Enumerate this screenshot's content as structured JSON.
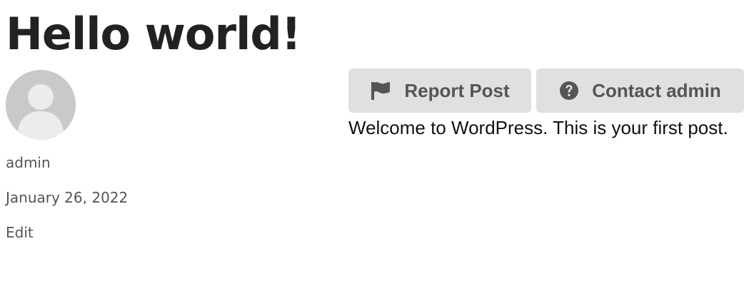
{
  "post": {
    "title": "Hello world!",
    "author": "admin",
    "date": "January 26, 2022",
    "edit_label": "Edit",
    "content": "Welcome to WordPress. This is your first post."
  },
  "actions": {
    "report_label": "Report Post",
    "report_icon": "flag-icon",
    "contact_label": "Contact admin",
    "contact_icon": "question-circle-icon"
  },
  "colors": {
    "button_bg": "#e0e0e0",
    "button_text": "#555555",
    "title_text": "#222222"
  }
}
